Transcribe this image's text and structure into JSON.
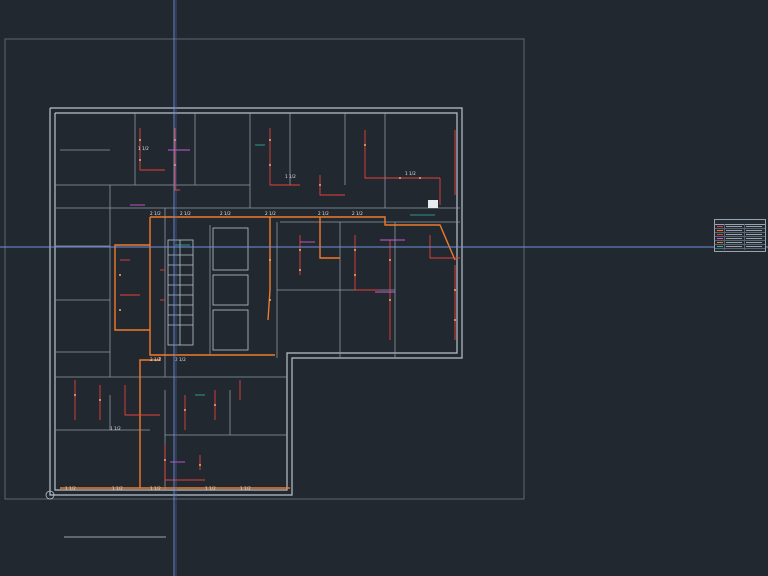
{
  "app": {
    "canvas_background": "#212830",
    "crosshair_color": "#6f8fd8"
  },
  "colors": {
    "wall": "#b9c3cc",
    "pipe_main": "#f07a2a",
    "pipe_branch": "#e8413a",
    "pipe_accent": "#cc5ad2",
    "teal": "#2fb8a8",
    "frame": "#707983"
  },
  "pipe_labels": {
    "main_corridor": [
      "2 1/2",
      "2 1/2",
      "2 1/2",
      "2 1/2",
      "2 1/2",
      "2 1/2"
    ],
    "riser_left": [
      "1 1/2",
      "1 1/2",
      "1 1/2"
    ],
    "lower_corridor": [
      "2 1/2",
      "2 1/2",
      "1 1/2"
    ],
    "bottom_run": [
      "1 1/2",
      "1 1/2",
      "1 1/2",
      "1 1/2",
      "1 1/2"
    ]
  },
  "legend": {
    "rows": 6
  }
}
